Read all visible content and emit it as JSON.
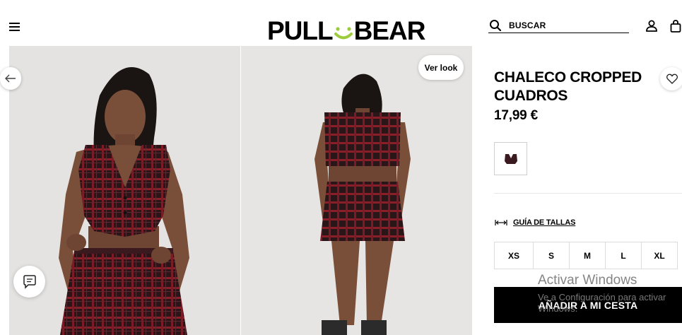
{
  "header": {
    "logo_left": "PULL",
    "logo_right": "BEAR",
    "search_label": "BUSCAR",
    "icons": [
      "menu-icon",
      "search-icon",
      "user-icon",
      "bag-icon"
    ]
  },
  "gallery": {
    "view_look_label": "Ver look",
    "icons": [
      "arrow-left-icon",
      "chat-icon"
    ]
  },
  "product": {
    "title": "CHALECO CROPPED CUADROS",
    "price": "17,99 €",
    "size_guide_label": "GUÍA DE TALLAS",
    "sizes": [
      "XS",
      "S",
      "M",
      "L",
      "XL"
    ],
    "add_to_cart_label": "AÑADIR A MI CESTA",
    "icons": [
      "heart-icon",
      "ruler-icon"
    ]
  },
  "watermark": {
    "title": "Activar Windows",
    "subtitle": "Ve a Configuración para activar Windows."
  },
  "colors": {
    "brand_smile": "#9ccb3b",
    "plaid_base": "#2a1518",
    "plaid_red": "#8a1f2a",
    "button_bg": "#000000"
  }
}
